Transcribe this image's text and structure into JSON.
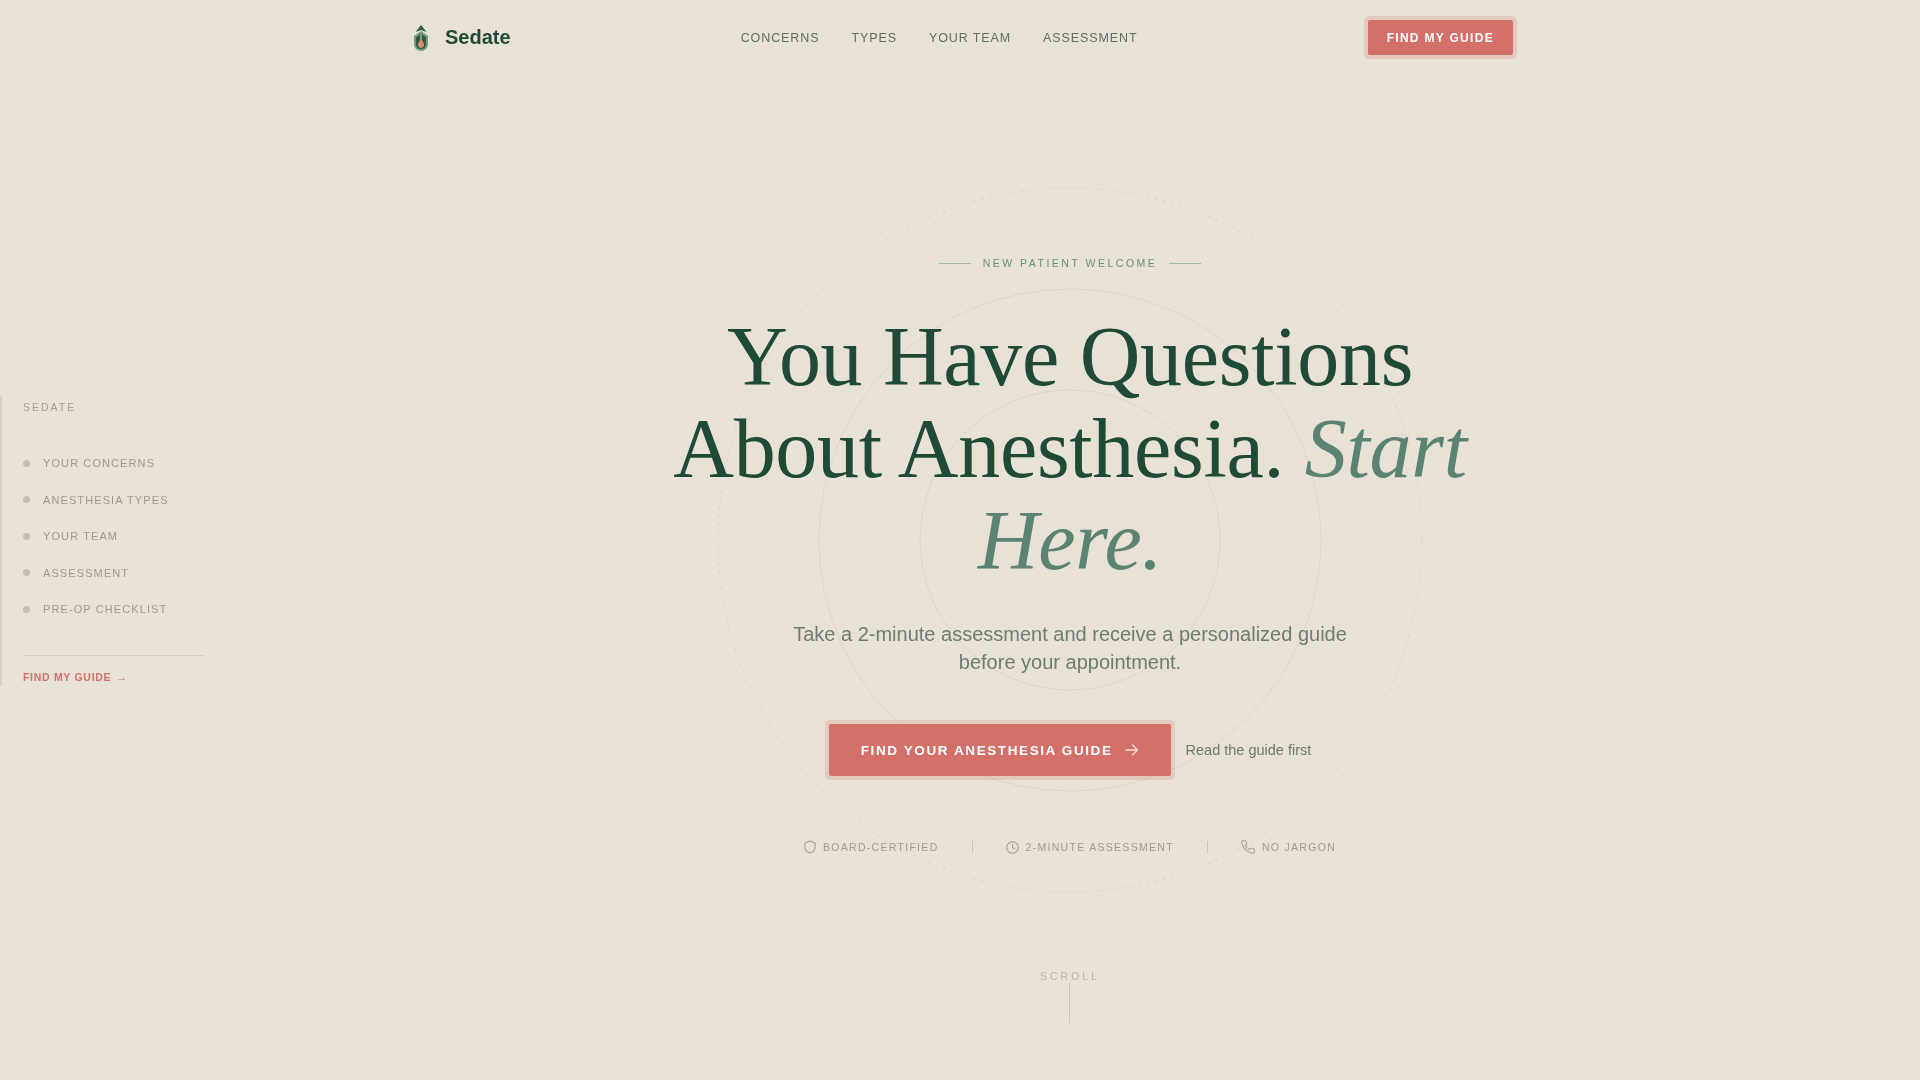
{
  "header": {
    "logo_text": "Sedate",
    "nav": [
      "CONCERNS",
      "TYPES",
      "YOUR TEAM",
      "ASSESSMENT"
    ],
    "button": "FIND MY GUIDE"
  },
  "sidebar": {
    "title": "SEDATE",
    "items": [
      "YOUR CONCERNS",
      "ANESTHESIA TYPES",
      "YOUR TEAM",
      "ASSESSMENT",
      "PRE-OP CHECKLIST"
    ],
    "link": {
      "label": "FIND MY GUIDE",
      "arrow": "→"
    }
  },
  "hero": {
    "eyebrow": "NEW PATIENT WELCOME",
    "headline": "You Have Questions About Anesthesia. *Start Here.*",
    "subtitle": "Take a 2-minute assessment and receive a personalized guide before your appointment.",
    "primary_button": "FIND YOUR ANESTHESIA GUIDE",
    "secondary_link": "Read the guide first",
    "trust_badges": [
      {
        "kind": "shield",
        "label": "BOARD-CERTIFIED"
      },
      {
        "kind": "clock",
        "label": "2-MINUTE ASSESSMENT"
      },
      {
        "kind": "phone",
        "label": "NO JARGON"
      }
    ],
    "scroll_hint": "SCROLL"
  }
}
